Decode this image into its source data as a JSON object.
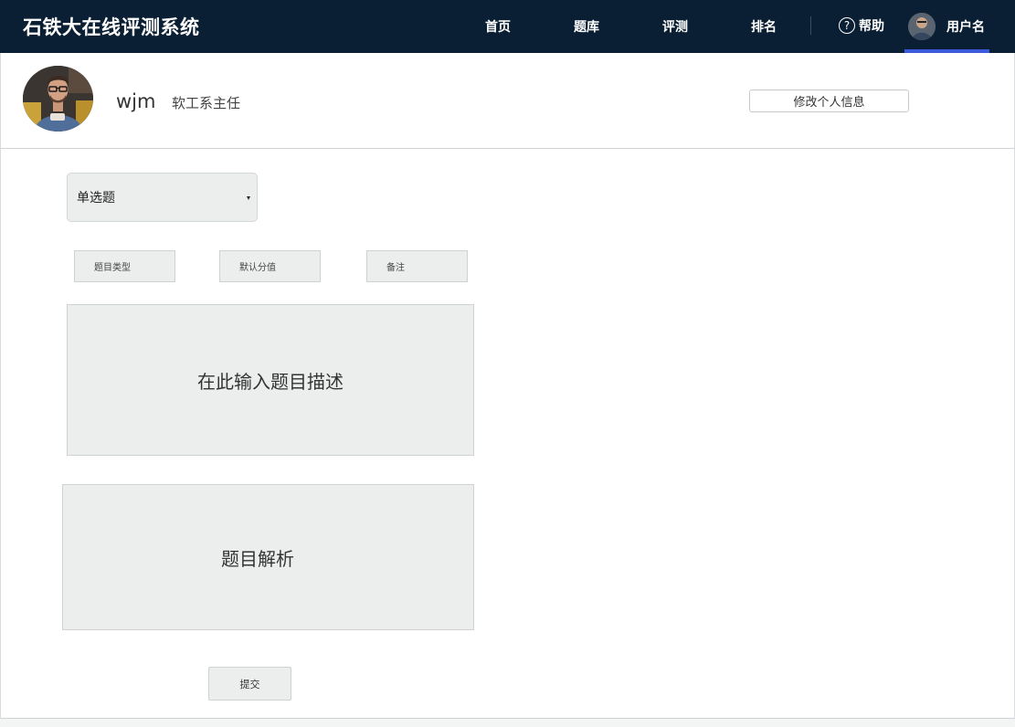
{
  "header": {
    "brand": "石铁大在线评测系统",
    "nav": [
      "首页",
      "题库",
      "评测",
      "排名"
    ],
    "help_label": "帮助",
    "help_icon_glyph": "?",
    "username": "用户名",
    "accent_color": "#3b5bdb",
    "bg_color": "#0a1f33"
  },
  "profile": {
    "name": "wjm",
    "role": "软工系主任",
    "edit_button": "修改个人信息"
  },
  "form": {
    "question_type_select": "单选题",
    "fields": {
      "type_placeholder": "题目类型",
      "score_placeholder": "默认分值",
      "note_placeholder": "备注"
    },
    "description_placeholder": "在此输入题目描述",
    "analysis_placeholder": "题目解析",
    "submit_label": "提交"
  },
  "icons": {
    "help": "question-circle-icon",
    "select_arrow": "caret-down-icon"
  }
}
